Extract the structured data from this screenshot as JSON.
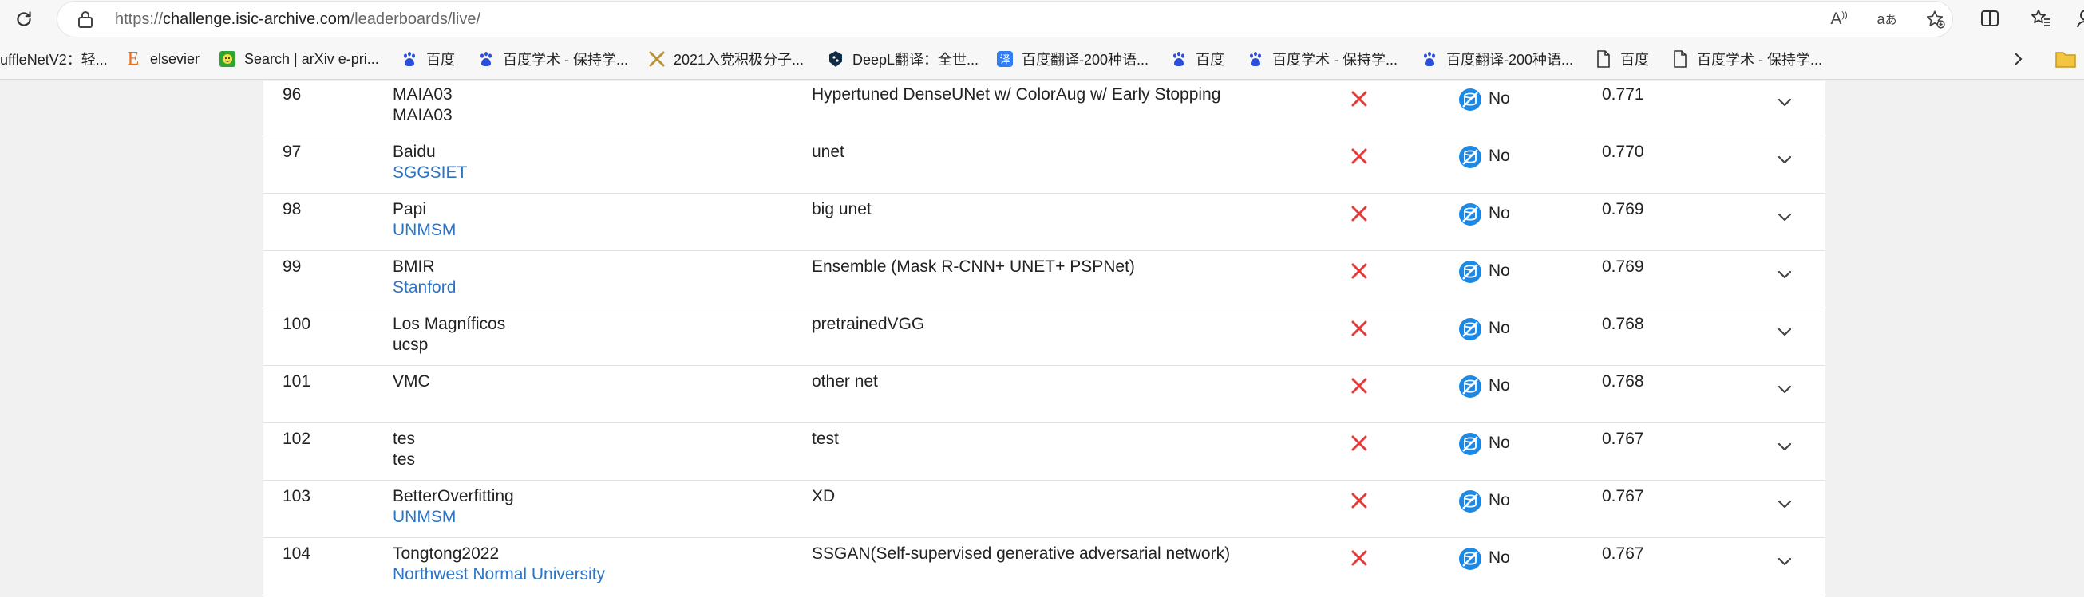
{
  "browser": {
    "url_scheme": "https://",
    "url_host": "challenge.isic-archive.com",
    "url_path": "/leaderboards/live/",
    "bookmarks": [
      {
        "label": "uffleNetV2：轻...",
        "icon": "page-icon"
      },
      {
        "label": "elsevier",
        "icon": "elsevier-icon"
      },
      {
        "label": "Search | arXiv e-pri...",
        "icon": "arxiv-icon"
      },
      {
        "label": "百度",
        "icon": "baidu-paw-icon"
      },
      {
        "label": "百度学术 - 保持学...",
        "icon": "baidu-paw-icon"
      },
      {
        "label": "2021入党积极分子...",
        "icon": "tools-icon"
      },
      {
        "label": "DeepL翻译：全世...",
        "icon": "deepl-icon"
      },
      {
        "label": "百度翻译-200种语...",
        "icon": "baidu-translate-icon"
      },
      {
        "label": "百度",
        "icon": "baidu-paw-icon"
      },
      {
        "label": "百度学术 - 保持学...",
        "icon": "baidu-paw-icon"
      },
      {
        "label": "百度翻译-200种语...",
        "icon": "baidu-paw-icon"
      },
      {
        "label": "百度",
        "icon": "page-icon"
      },
      {
        "label": "百度学术 - 保持学...",
        "icon": "page-icon"
      }
    ]
  },
  "leaderboard": {
    "rows": [
      {
        "rank": "96",
        "team": "MAIA03",
        "org": "MAIA03",
        "org_link": false,
        "method": "Hypertuned DenseUNet w/ ColorAug w/ Early Stopping",
        "external": "No",
        "score": "0.771"
      },
      {
        "rank": "97",
        "team": "Baidu",
        "org": "SGGSIET",
        "org_link": true,
        "method": "unet",
        "external": "No",
        "score": "0.770"
      },
      {
        "rank": "98",
        "team": "Papi",
        "org": "UNMSM",
        "org_link": true,
        "method": "big unet",
        "external": "No",
        "score": "0.769"
      },
      {
        "rank": "99",
        "team": "BMIR",
        "org": "Stanford",
        "org_link": true,
        "method": "Ensemble (Mask R-CNN+ UNET+ PSPNet)",
        "external": "No",
        "score": "0.769"
      },
      {
        "rank": "100",
        "team": "Los Magníficos",
        "org": "ucsp",
        "org_link": false,
        "method": "pretrainedVGG",
        "external": "No",
        "score": "0.768"
      },
      {
        "rank": "101",
        "team": "VMC",
        "org": "",
        "org_link": false,
        "method": "other net",
        "external": "No",
        "score": "0.768"
      },
      {
        "rank": "102",
        "team": "tes",
        "org": "tes",
        "org_link": false,
        "method": "test",
        "external": "No",
        "score": "0.767"
      },
      {
        "rank": "103",
        "team": "BetterOverfitting",
        "org": "UNMSM",
        "org_link": true,
        "method": "XD",
        "external": "No",
        "score": "0.767"
      },
      {
        "rank": "104",
        "team": "Tongtong2022",
        "org": "Northwest Normal University",
        "org_link": true,
        "method": "SSGAN(Self-supervised generative adversarial network)",
        "external": "No",
        "score": "0.767"
      }
    ]
  },
  "colors": {
    "accent": "#2d74c5",
    "x_mark": "#e53935",
    "ext_badge": "#1e88e5"
  }
}
